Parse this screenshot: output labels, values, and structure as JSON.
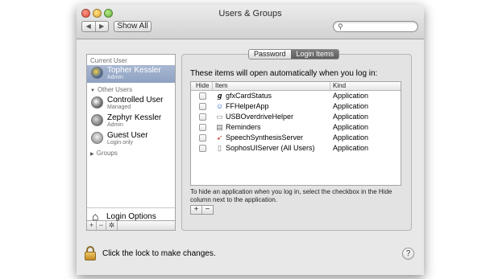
{
  "window": {
    "title": "Users & Groups"
  },
  "toolbar": {
    "back": "◀",
    "forward": "▶",
    "show_all_label": "Show All",
    "search_placeholder": ""
  },
  "sidebar": {
    "current_user_header": "Current User",
    "current_user": {
      "name": "Topher Kessler",
      "role": "Admin"
    },
    "other_users_header": "Other Users",
    "other_users": [
      {
        "name": "Controlled User",
        "role": "Managed"
      },
      {
        "name": "Zephyr Kessler",
        "role": "Admin"
      },
      {
        "name": "Guest User",
        "role": "Login only"
      }
    ],
    "groups_label": "Groups",
    "login_options_label": "Login Options",
    "add": "+",
    "remove": "−",
    "gear": "✲"
  },
  "tabs": {
    "password": "Password",
    "login_items": "Login Items",
    "active": "Login Items"
  },
  "login_items": {
    "heading": "These items will open automatically when you log in:",
    "columns": {
      "hide": "Hide",
      "item": "Item",
      "kind": "Kind"
    },
    "rows": [
      {
        "icon": "𝒈",
        "name": "gfxCardStatus",
        "kind": "Application"
      },
      {
        "icon": "☺",
        "name": "FFHelperApp",
        "kind": "Application"
      },
      {
        "icon": "▭",
        "name": "USBOverdriveHelper",
        "kind": "Application"
      },
      {
        "icon": "▤",
        "name": "Reminders",
        "kind": "Application"
      },
      {
        "icon": "➹",
        "name": "SpeechSynthesisServer",
        "kind": "Application"
      },
      {
        "icon": "▯",
        "name": "SophosUIServer (All Users)",
        "kind": "Application"
      }
    ],
    "note": "To hide an application when you log in, select the checkbox in the Hide column next to the application.",
    "add": "+",
    "remove": "−"
  },
  "footer": {
    "lock_text": "Click the lock to make changes.",
    "help": "?"
  },
  "colors": {
    "selection": "#8ea1c3",
    "window": "#e8e8e8"
  }
}
